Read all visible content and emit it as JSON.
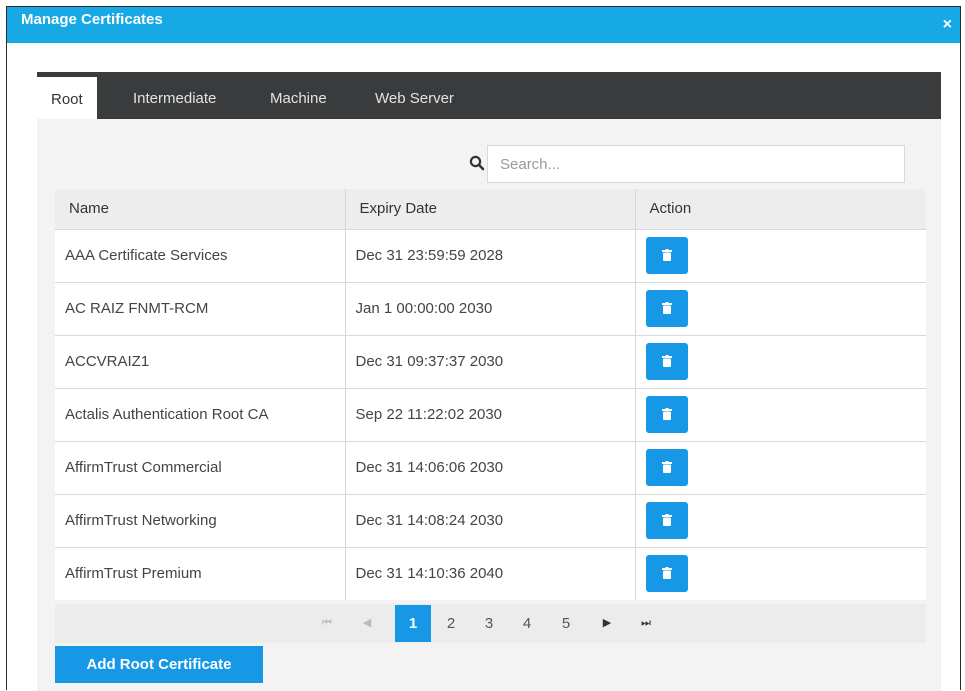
{
  "dialog": {
    "title": "Manage Certificates",
    "close_glyph": "×"
  },
  "tabs": [
    {
      "label": "Root",
      "active": true
    },
    {
      "label": "Intermediate",
      "active": false
    },
    {
      "label": "Machine",
      "active": false
    },
    {
      "label": "Web Server",
      "active": false
    }
  ],
  "search": {
    "placeholder": "Search...",
    "value": "",
    "icon": "search-icon"
  },
  "table": {
    "columns": [
      "Name",
      "Expiry Date",
      "Action"
    ],
    "rows": [
      {
        "name": "AAA Certificate Services",
        "expiry": "Dec 31 23:59:59 2028"
      },
      {
        "name": "AC RAIZ FNMT-RCM",
        "expiry": "Jan 1 00:00:00 2030"
      },
      {
        "name": "ACCVRAIZ1",
        "expiry": "Dec 31 09:37:37 2030"
      },
      {
        "name": "Actalis Authentication Root CA",
        "expiry": "Sep 22 11:22:02 2030"
      },
      {
        "name": "AffirmTrust Commercial",
        "expiry": "Dec 31 14:06:06 2030"
      },
      {
        "name": "AffirmTrust Networking",
        "expiry": "Dec 31 14:08:24 2030"
      },
      {
        "name": "AffirmTrust Premium",
        "expiry": "Dec 31 14:10:36 2040"
      }
    ],
    "row_action_icon": "trash-icon"
  },
  "pagination": {
    "first": "⏮",
    "prev": "◀",
    "next": "▶",
    "last": "⏭",
    "pages": [
      "1",
      "2",
      "3",
      "4",
      "5"
    ],
    "current": "1"
  },
  "footer": {
    "add_label": "Add Root Certificate"
  },
  "colors": {
    "title_bar": "#16a9e6",
    "tab_bar": "#3a3b3c",
    "accent": "#1698e6"
  }
}
